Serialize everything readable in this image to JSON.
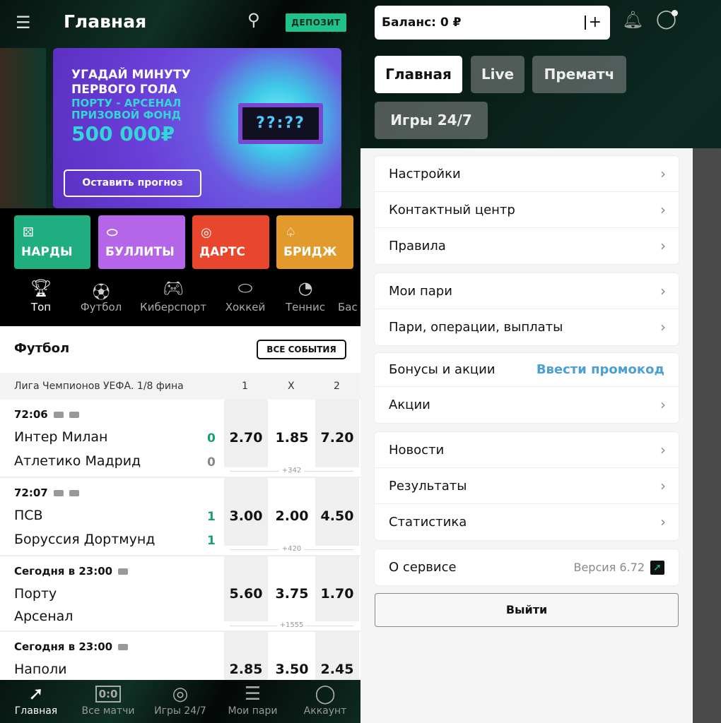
{
  "left": {
    "header": {
      "menu_icon": "hamburger-icon",
      "title": "Главная",
      "search_icon": "search-icon",
      "deposit_label": "ДЕПОЗИТ"
    },
    "banner": {
      "line1": "УГАДАЙ МИНУТУ",
      "line2": "ПЕРВОГО ГОЛА",
      "line3": "ПОРТУ - АРСЕНАЛ",
      "line4": "ПРИЗОВОЙ ФОНД",
      "prize": "500 000₽",
      "clock": "??:??",
      "cta": "Оставить прогноз"
    },
    "games": [
      {
        "label": "НАРДЫ",
        "color": "#1fae7f"
      },
      {
        "label": "БУЛЛИТЫ",
        "color": "#b565e8"
      },
      {
        "label": "ДАРТС",
        "color": "#e8472e"
      },
      {
        "label": "БРИДЖ",
        "color": "#e39a2c"
      }
    ],
    "sports": [
      {
        "label": "Топ",
        "icon": "trophy-icon"
      },
      {
        "label": "Футбол",
        "icon": "soccer-ball-icon"
      },
      {
        "label": "Киберспорт",
        "icon": "gamepad-icon"
      },
      {
        "label": "Хоккей",
        "icon": "puck-icon"
      },
      {
        "label": "Теннис",
        "icon": "tennis-ball-icon"
      },
      {
        "label": "Бас",
        "icon": "basketball-icon"
      }
    ],
    "section": {
      "title": "Футбол",
      "all_events": "ВСЕ СОБЫТИЯ",
      "league": "Лига Чемпионов УЕФА. 1/8 фина",
      "col1": "1",
      "colx": "X",
      "col2": "2"
    },
    "matches": [
      {
        "time": "72:06",
        "home": "Интер Милан",
        "away": "Атлетико Мадрид",
        "home_score": "0",
        "away_score": "0",
        "odds": [
          "2.70",
          "1.85",
          "7.20"
        ],
        "more": "+342"
      },
      {
        "time": "72:07",
        "home": "ПСВ",
        "away": "Боруссия Дортмунд",
        "home_score": "1",
        "away_score": "1",
        "odds": [
          "3.00",
          "2.00",
          "4.50"
        ],
        "more": "+420"
      },
      {
        "time": "Сегодня в 23:00",
        "home": "Порту",
        "away": "Арсенал",
        "odds": [
          "5.60",
          "3.75",
          "1.70"
        ],
        "more": "+1555"
      },
      {
        "time": "Сегодня в 23:00",
        "home": "Наполи",
        "odds": [
          "2.85",
          "3.50",
          "2.45"
        ]
      }
    ],
    "bottom_nav": [
      {
        "label": "Главная",
        "icon": "arrow-logo-icon",
        "active": true
      },
      {
        "label": "Все матчи",
        "icon": "scoreboard-icon"
      },
      {
        "label": "Игры 24/7",
        "icon": "target-icon"
      },
      {
        "label": "Мои пари",
        "icon": "receipt-icon"
      },
      {
        "label": "Аккаунт",
        "icon": "user-icon"
      }
    ]
  },
  "right": {
    "balance": "Баланс: 0 ₽",
    "plus": "+",
    "tabs": [
      {
        "label": "Главная",
        "active": true
      },
      {
        "label": "Live"
      },
      {
        "label": "Прематч"
      },
      {
        "label": "Игры 24/7"
      }
    ],
    "groups": [
      [
        {
          "label": "Настройки"
        },
        {
          "label": "Контактный центр"
        },
        {
          "label": "Правила"
        }
      ],
      [
        {
          "label": "Мои пари"
        },
        {
          "label": "Пари, операции, выплаты"
        }
      ],
      [
        {
          "label": "Бонусы и акции",
          "link": "Ввести промокод"
        },
        {
          "label": "Акции"
        }
      ],
      [
        {
          "label": "Новости"
        },
        {
          "label": "Результаты"
        },
        {
          "label": "Статистика"
        }
      ]
    ],
    "about": {
      "label": "О сервисе",
      "version": "Версия 6.72"
    },
    "logout": "Выйти",
    "chevron": "›"
  }
}
